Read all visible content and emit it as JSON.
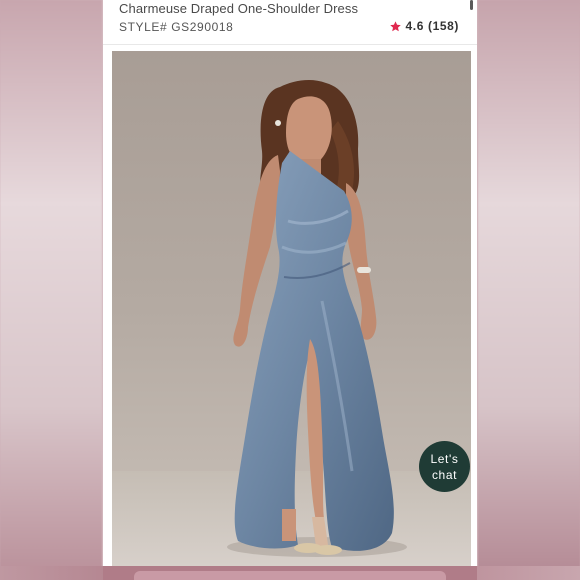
{
  "product": {
    "title": "Charmeuse Draped One-Shoulder Dress",
    "style_label": "STYLE#",
    "style_number": "GS290018",
    "rating_value": "4.6",
    "review_count": "(158)",
    "star_color": "#e0284f"
  },
  "chat": {
    "line1": "Let's",
    "line2": "chat",
    "color": "#1f3b35"
  },
  "icons": {
    "rating": "star-icon",
    "photo": "dress-model-photo"
  }
}
